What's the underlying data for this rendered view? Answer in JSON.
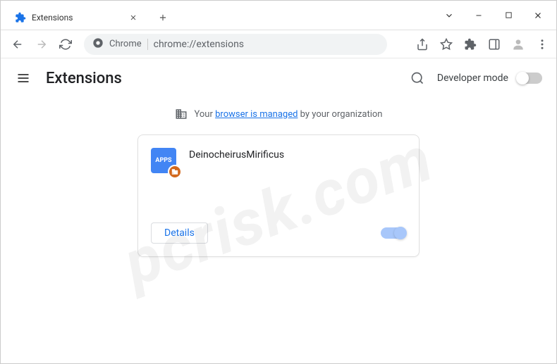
{
  "window": {
    "tab_title": "Extensions",
    "url_chip": "Chrome",
    "url": "chrome://extensions"
  },
  "page": {
    "title": "Extensions",
    "dev_mode_label": "Developer mode"
  },
  "notice": {
    "prefix": "Your ",
    "link": "browser is managed",
    "suffix": " by your organization"
  },
  "extension": {
    "name": "DeinocheirusMirificus",
    "icon_text": "APPS",
    "details_label": "Details"
  },
  "watermark": "pcrisk.com"
}
